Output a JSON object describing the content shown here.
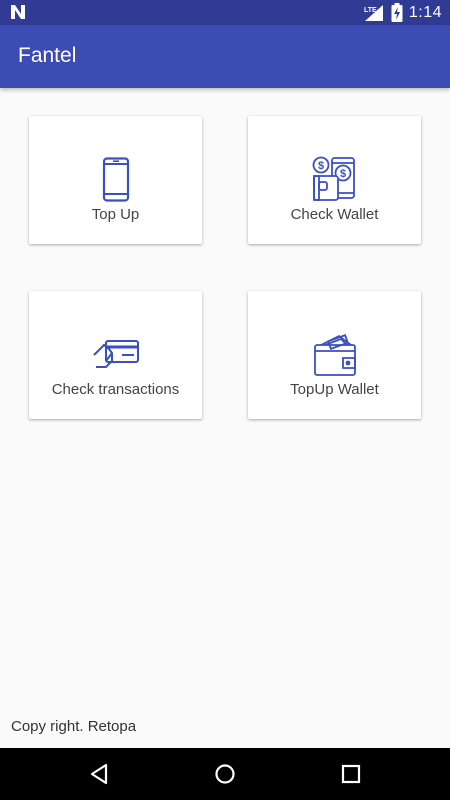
{
  "status_bar": {
    "time": "1:14",
    "network_type": "LTE",
    "icons": [
      "n-logo-icon",
      "signal-icon",
      "battery-charging-icon"
    ]
  },
  "app_bar": {
    "title": "Fantel"
  },
  "menu": [
    {
      "label": "Top Up",
      "icon": "mobile-phone-icon"
    },
    {
      "label": "Check Wallet",
      "icon": "wallet-phone-icon"
    },
    {
      "label": "Check transactions",
      "icon": "card-hand-icon"
    },
    {
      "label": "TopUp Wallet",
      "icon": "wallet-cash-icon"
    }
  ],
  "footer": {
    "text": "Copy right. Retopa"
  },
  "colors": {
    "primary": "#3b4db5",
    "primary_dark": "#2f3b95",
    "icon": "#3a4fc4",
    "background": "#fafafa"
  }
}
